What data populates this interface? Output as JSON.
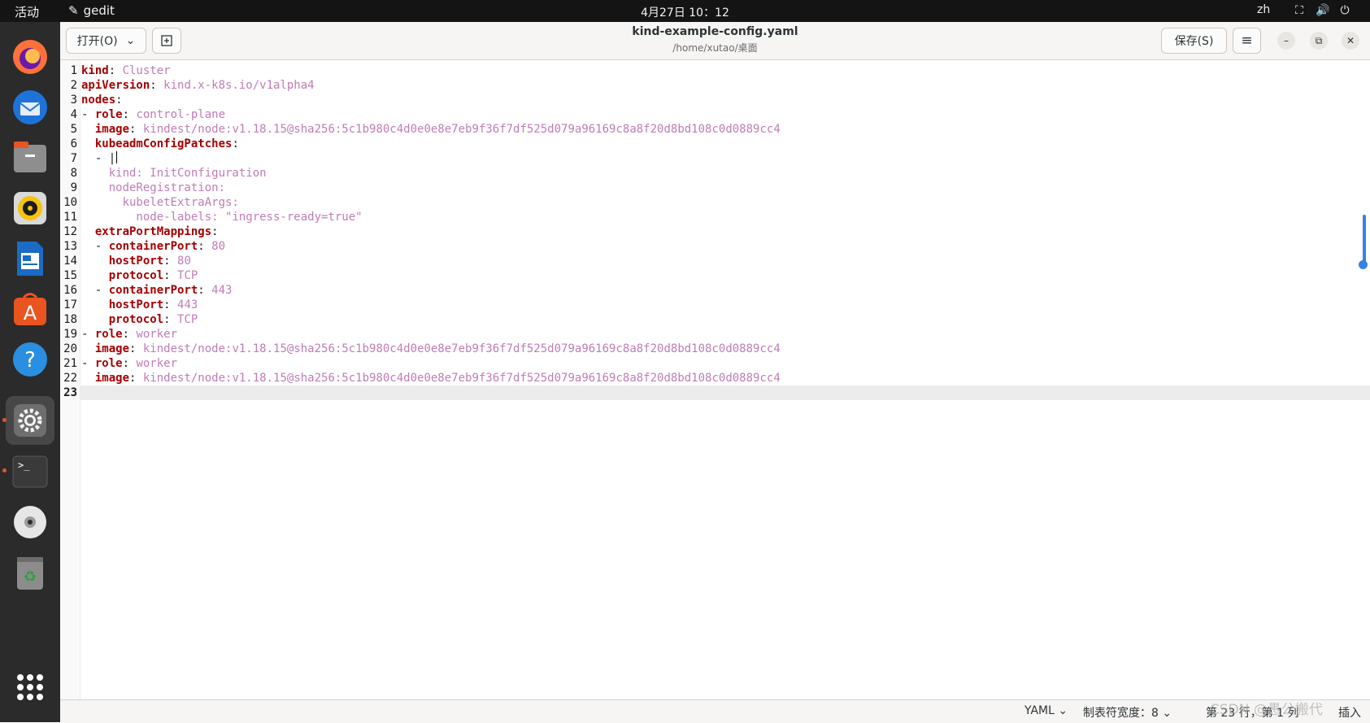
{
  "topbar": {
    "activities": "活动",
    "app_name": "gedit",
    "clock": "4月27日 10：12",
    "language": "zh",
    "tray_icons": [
      "network-icon",
      "volume-icon",
      "power-icon"
    ]
  },
  "dock": {
    "items": [
      "firefox-icon",
      "thunderbird-icon",
      "files-icon",
      "rhythmbox-icon",
      "libreoffice-writer-icon",
      "software-center-icon",
      "help-icon",
      "settings-icon",
      "terminal-icon",
      "dvd-icon",
      "trash-icon"
    ],
    "active": "settings-icon",
    "running": [
      "settings-icon",
      "terminal-icon"
    ],
    "show_apps": "app-grid-icon"
  },
  "header": {
    "open_label": "打开(O)",
    "title": "kind-example-config.yaml",
    "subtitle": "/home/xutao/桌面",
    "save_label": "保存(S)"
  },
  "editor": {
    "line_numbers": [
      "1",
      "2",
      "3",
      "4",
      "5",
      "6",
      "7",
      "8",
      "9",
      "10",
      "11",
      "12",
      "13",
      "14",
      "15",
      "16",
      "17",
      "18",
      "19",
      "20",
      "21",
      "22",
      "23"
    ],
    "current_line": 23,
    "lines": [
      [
        {
          "t": "k",
          "s": "kind"
        },
        {
          "t": "p",
          "s": ": "
        },
        {
          "t": "v",
          "s": "Cluster"
        }
      ],
      [
        {
          "t": "k",
          "s": "apiVersion"
        },
        {
          "t": "p",
          "s": ": "
        },
        {
          "t": "v",
          "s": "kind.x-k8s.io/v1alpha4"
        }
      ],
      [
        {
          "t": "k",
          "s": "nodes"
        },
        {
          "t": "p",
          "s": ":"
        }
      ],
      [
        {
          "t": "p",
          "s": "- "
        },
        {
          "t": "k",
          "s": "role"
        },
        {
          "t": "p",
          "s": ": "
        },
        {
          "t": "v",
          "s": "control-plane"
        }
      ],
      [
        {
          "t": "p",
          "s": "  "
        },
        {
          "t": "k",
          "s": "image"
        },
        {
          "t": "p",
          "s": ": "
        },
        {
          "t": "v",
          "s": "kindest/node:v1.18.15@sha256:5c1b980c4d0e0e8e7eb9f36f7df525d079a96169c8a8f20d8bd108c0d0889cc4"
        }
      ],
      [
        {
          "t": "p",
          "s": "  "
        },
        {
          "t": "k",
          "s": "kubeadmConfigPatches"
        },
        {
          "t": "p",
          "s": ":"
        }
      ],
      [
        {
          "t": "p",
          "s": "  - |"
        }
      ],
      [
        {
          "t": "v",
          "s": "    kind: InitConfiguration"
        }
      ],
      [
        {
          "t": "v",
          "s": "    nodeRegistration:"
        }
      ],
      [
        {
          "t": "v",
          "s": "      kubeletExtraArgs:"
        }
      ],
      [
        {
          "t": "v",
          "s": "        node-labels: \"ingress-ready=true\""
        }
      ],
      [
        {
          "t": "p",
          "s": "  "
        },
        {
          "t": "k",
          "s": "extraPortMappings"
        },
        {
          "t": "p",
          "s": ":"
        }
      ],
      [
        {
          "t": "p",
          "s": "  - "
        },
        {
          "t": "k",
          "s": "containerPort"
        },
        {
          "t": "p",
          "s": ": "
        },
        {
          "t": "v",
          "s": "80"
        }
      ],
      [
        {
          "t": "p",
          "s": "    "
        },
        {
          "t": "k",
          "s": "hostPort"
        },
        {
          "t": "p",
          "s": ": "
        },
        {
          "t": "v",
          "s": "80"
        }
      ],
      [
        {
          "t": "p",
          "s": "    "
        },
        {
          "t": "k",
          "s": "protocol"
        },
        {
          "t": "p",
          "s": ": "
        },
        {
          "t": "v",
          "s": "TCP"
        }
      ],
      [
        {
          "t": "p",
          "s": "  - "
        },
        {
          "t": "k",
          "s": "containerPort"
        },
        {
          "t": "p",
          "s": ": "
        },
        {
          "t": "v",
          "s": "443"
        }
      ],
      [
        {
          "t": "p",
          "s": "    "
        },
        {
          "t": "k",
          "s": "hostPort"
        },
        {
          "t": "p",
          "s": ": "
        },
        {
          "t": "v",
          "s": "443"
        }
      ],
      [
        {
          "t": "p",
          "s": "    "
        },
        {
          "t": "k",
          "s": "protocol"
        },
        {
          "t": "p",
          "s": ": "
        },
        {
          "t": "v",
          "s": "TCP"
        }
      ],
      [
        {
          "t": "p",
          "s": "- "
        },
        {
          "t": "k",
          "s": "role"
        },
        {
          "t": "p",
          "s": ": "
        },
        {
          "t": "v",
          "s": "worker"
        }
      ],
      [
        {
          "t": "p",
          "s": "  "
        },
        {
          "t": "k",
          "s": "image"
        },
        {
          "t": "p",
          "s": ": "
        },
        {
          "t": "v",
          "s": "kindest/node:v1.18.15@sha256:5c1b980c4d0e0e8e7eb9f36f7df525d079a96169c8a8f20d8bd108c0d0889cc4"
        }
      ],
      [
        {
          "t": "p",
          "s": "- "
        },
        {
          "t": "k",
          "s": "role"
        },
        {
          "t": "p",
          "s": ": "
        },
        {
          "t": "v",
          "s": "worker"
        }
      ],
      [
        {
          "t": "p",
          "s": "  "
        },
        {
          "t": "k",
          "s": "image"
        },
        {
          "t": "p",
          "s": ": "
        },
        {
          "t": "v",
          "s": "kindest/node:v1.18.15@sha256:5c1b980c4d0e0e8e7eb9f36f7df525d079a96169c8a8f20d8bd108c0d0889cc4"
        }
      ],
      []
    ]
  },
  "statusbar": {
    "language": "YAML",
    "tab_width": "制表符宽度：8",
    "position": "第 23 行，第 1 列",
    "mode": "插入"
  },
  "watermark": "CSDN @愚公搬代",
  "colors": {
    "key": "#a40000",
    "value": "#c07cb6",
    "accent": "#3584e4",
    "running_dot": "#e95420"
  }
}
